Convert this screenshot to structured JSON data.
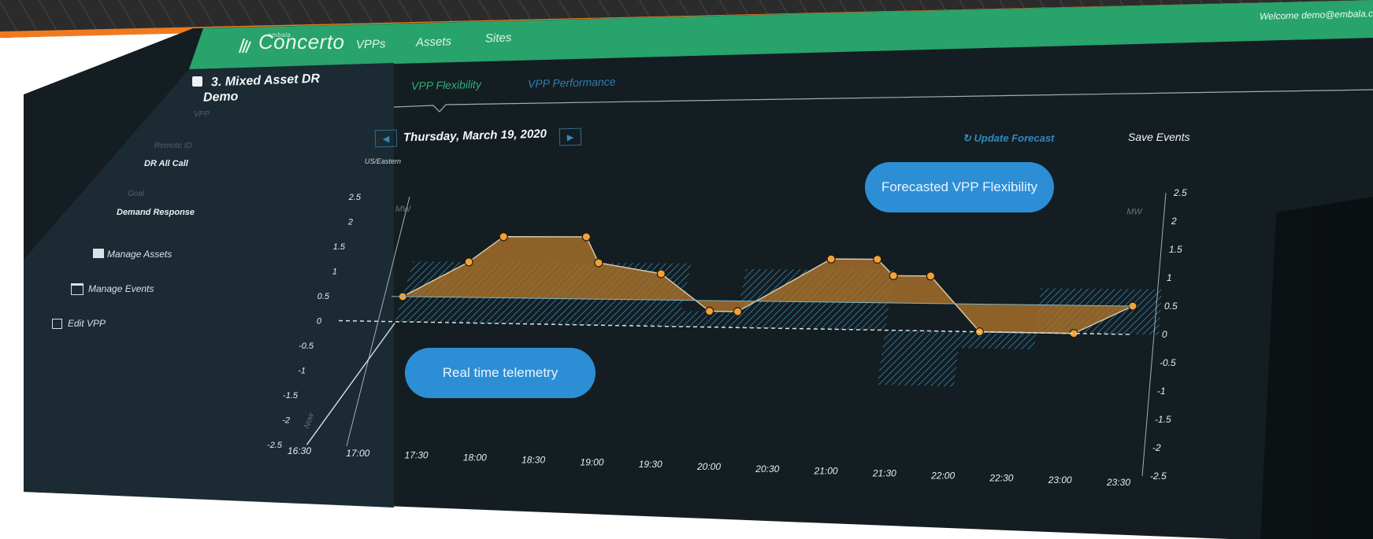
{
  "header": {
    "logo_small": "embala",
    "logo": "Concerto",
    "nav": [
      "VPPs",
      "Assets",
      "Sites"
    ],
    "welcome": "Welcome demo@embala.c"
  },
  "sidebar": {
    "vpp_title_line1": "3. Mixed Asset DR",
    "vpp_title_line2": "Demo",
    "vpp_sub": "VPP",
    "remote_id_label": "Remote ID",
    "remote_id_value": "DR All Call",
    "goal_label": "Goal",
    "goal_value": "Demand Response",
    "actions": [
      {
        "label": "Manage Assets",
        "icon": "folder-icon"
      },
      {
        "label": "Manage Events",
        "icon": "calendar-icon"
      },
      {
        "label": "Edit VPP",
        "icon": "edit-icon"
      }
    ]
  },
  "tabs": [
    "VPP Flexibility",
    "VPP Performance"
  ],
  "toolbar": {
    "date": "Thursday, March 19, 2020",
    "timezone": "US/Eastern",
    "update_forecast": "Update Forecast",
    "save_events": "Save Events",
    "prev_icon": "chevron-left-icon",
    "next_icon": "chevron-right-icon"
  },
  "annotations": {
    "forecast": "Forecasted VPP Flexibility",
    "telemetry": "Real time telemetry"
  },
  "colors": {
    "header_green": "#27a36b",
    "accent_blue": "#2c8fd6",
    "orange_fill": "#a8702a",
    "orange_point": "#f0a33a",
    "hatch_blue": "#2e7ea3",
    "tab_active": "#2bb37a",
    "tab_inactive": "#2f7fb0"
  },
  "chart_data": {
    "type": "area",
    "x_ticks": [
      "16:30",
      "17:00",
      "17:30",
      "18:00",
      "18:30",
      "19:00",
      "19:30",
      "20:00",
      "20:30",
      "21:00",
      "21:30",
      "22:00",
      "22:30",
      "23:00",
      "23:30"
    ],
    "y_left_ticks": [
      "2.5",
      "2",
      "1.5",
      "1",
      "0.5",
      "0",
      "-0.5",
      "-1",
      "-1.5",
      "-2",
      "-2.5"
    ],
    "y_right_ticks": [
      "2.5",
      "2",
      "1.5",
      "1",
      "0.5",
      "0",
      "-0.5",
      "-1",
      "-1.5",
      "-2",
      "-2.5"
    ],
    "ylabel_left": "MW",
    "ylabel_right": "MW",
    "now_label": "Now",
    "ylim": [
      -2.5,
      2.5
    ],
    "baseline_mw": 0.5,
    "forecast_series": [
      {
        "x": "17:00",
        "y": 0.5
      },
      {
        "x": "17:30",
        "y": 1.2
      },
      {
        "x": "17:45",
        "y": 1.7
      },
      {
        "x": "18:30",
        "y": 1.7
      },
      {
        "x": "18:40",
        "y": 1.2
      },
      {
        "x": "19:15",
        "y": 1.0
      },
      {
        "x": "19:45",
        "y": 0.3
      },
      {
        "x": "20:00",
        "y": 0.3
      },
      {
        "x": "20:45",
        "y": 1.3
      },
      {
        "x": "21:10",
        "y": 1.3
      },
      {
        "x": "21:20",
        "y": 1.0
      },
      {
        "x": "21:40",
        "y": 1.0
      },
      {
        "x": "22:10",
        "y": 0.0
      },
      {
        "x": "23:00",
        "y": 0.0
      },
      {
        "x": "23:30",
        "y": 0.5
      }
    ],
    "telemetry_blocks": [
      {
        "from": "17:00",
        "to": "19:30",
        "y": 1.2
      },
      {
        "from": "19:30",
        "to": "20:00",
        "y": 0.3
      },
      {
        "from": "20:00",
        "to": "21:20",
        "y": 1.1
      },
      {
        "from": "21:20",
        "to": "22:00",
        "y": -1.0
      },
      {
        "from": "22:00",
        "to": "22:40",
        "y": -0.3
      },
      {
        "from": "22:40",
        "to": "23:45",
        "y": 0.8
      }
    ],
    "grid": false
  }
}
